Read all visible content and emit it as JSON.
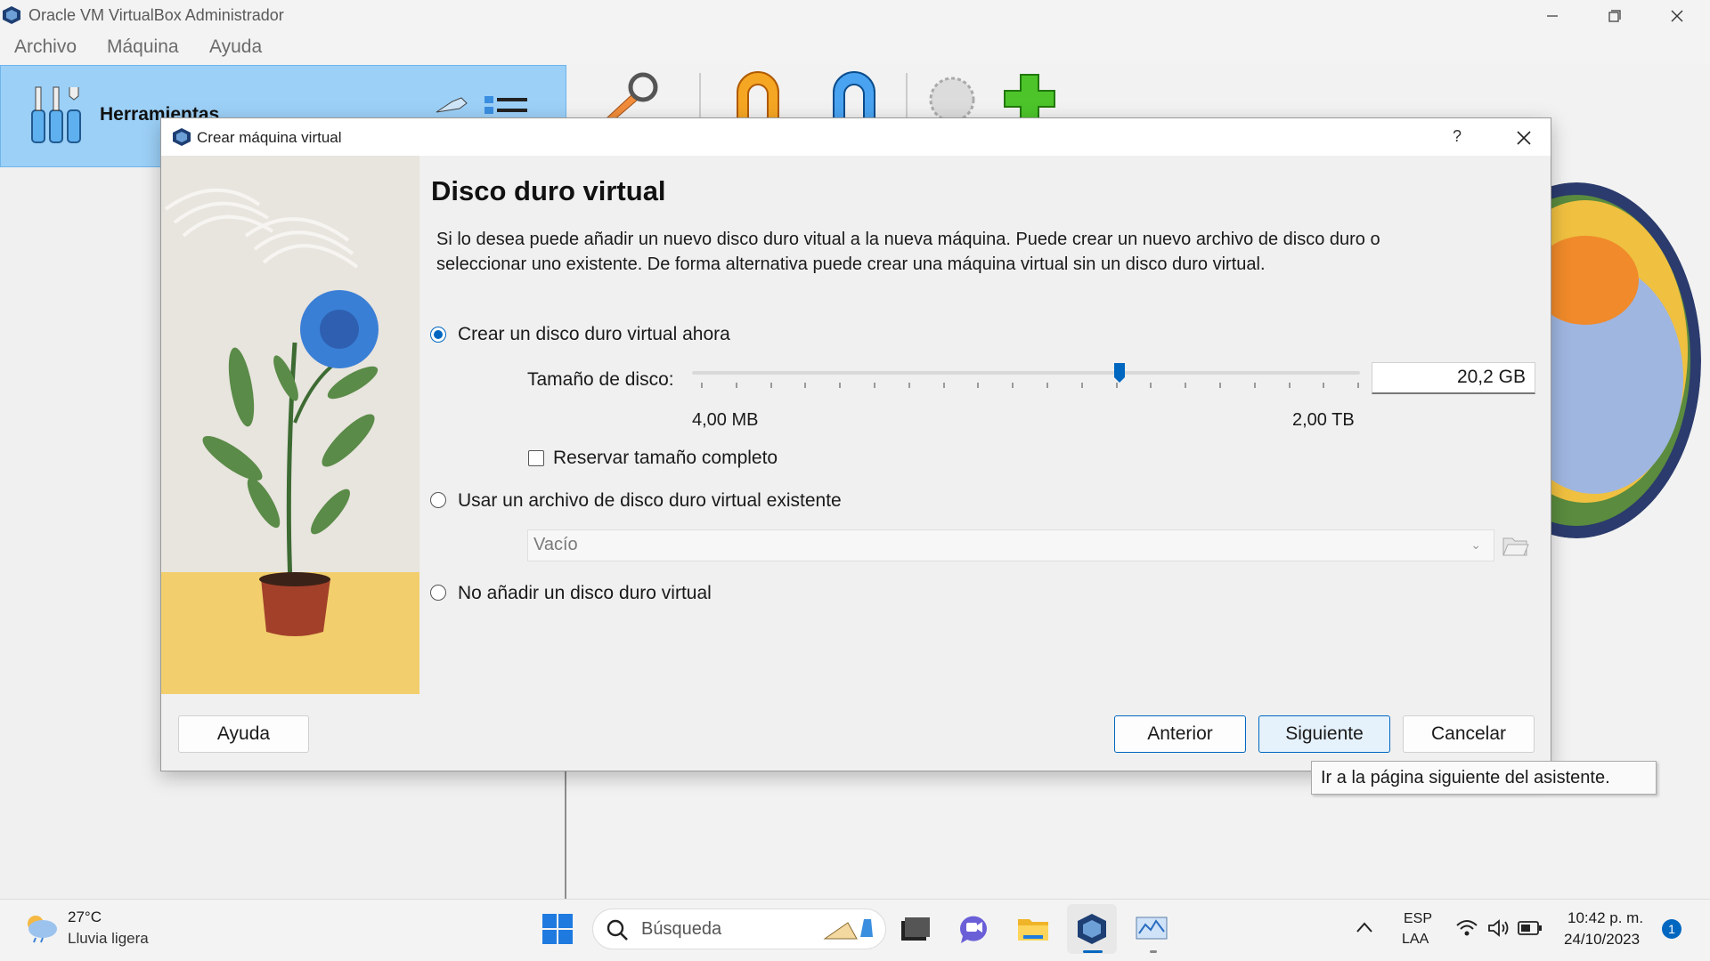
{
  "window": {
    "title": "Oracle VM VirtualBox Administrador",
    "menu": [
      "Archivo",
      "Máquina",
      "Ayuda"
    ],
    "tools_label": "Herramientas"
  },
  "dialog": {
    "title": "Crear máquina virtual",
    "help_glyph": "?",
    "heading": "Disco duro virtual",
    "description": "Si lo desea puede añadir un nuevo disco duro vitual a la nueva máquina. Puede crear un nuevo archivo de disco duro o seleccionar uno existente. De forma alternativa puede crear una máquina virtual sin un disco duro virtual.",
    "options": {
      "create_now": "Crear un disco duro virtual ahora",
      "use_existing": "Usar un archivo de disco duro virtual existente",
      "no_disk": "No añadir un disco duro virtual"
    },
    "selected_option": "create_now",
    "disk_size_label": "Tamaño de disco:",
    "disk_size_value": "20,2 GB",
    "slider_position": 0.64,
    "range_min": "4,00 MB",
    "range_max": "2,00 TB",
    "reserve_full_label": "Reservar tamaño completo",
    "reserve_full_checked": false,
    "existing_combo_value": "Vacío",
    "buttons": {
      "help": "Ayuda",
      "back": "Anterior",
      "next": "Siguiente",
      "cancel": "Cancelar"
    },
    "tooltip": "Ir a la página siguiente del asistente."
  },
  "taskbar": {
    "weather_temp": "27°C",
    "weather_desc": "Lluvia ligera",
    "search_placeholder": "Búsqueda",
    "lang_line1": "ESP",
    "lang_line2": "LAA",
    "time": "10:42 p. m.",
    "date": "24/10/2023",
    "notification_count": "1"
  },
  "colors": {
    "accent": "#0067c0",
    "tools_panel": "#9cd0f7"
  }
}
